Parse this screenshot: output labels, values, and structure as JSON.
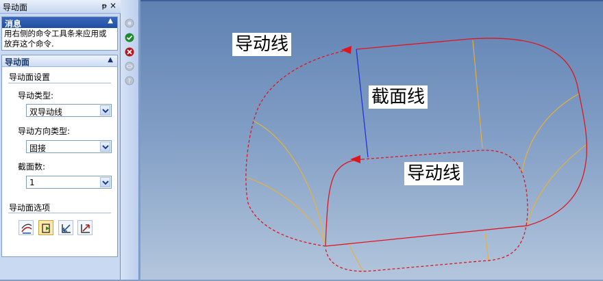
{
  "panel": {
    "title": "导动面",
    "pin_glyph": "ᵽ",
    "close_glyph": "×"
  },
  "message": {
    "header": "消息",
    "line1": "用右侧的命令工具条来应用或",
    "line2": "放弃这个命令."
  },
  "guide": {
    "header": "导动面",
    "settings_title": "导动面设置",
    "type_label": "导动类型:",
    "type_value": "双导动线",
    "direction_label": "导动方向类型:",
    "direction_value": "固接",
    "sections_label": "截面数:",
    "sections_value": "1",
    "options_title": "导动面选项",
    "option_buttons": [
      "sweep-option-1",
      "sweep-option-2",
      "sweep-option-3",
      "sweep-option-4"
    ]
  },
  "toolbar": {
    "buttons": [
      "disabled-circle",
      "apply-check",
      "cancel-x",
      "disabled-preview",
      "disabled-help"
    ]
  },
  "viewport": {
    "label_top_guide": "导动线",
    "label_section": "截面线",
    "label_bottom_guide": "导动线",
    "colors": {
      "guide_curve": "#e0141e",
      "section_curve": "#1f33d8",
      "iso_lines": "#f0b030"
    }
  }
}
